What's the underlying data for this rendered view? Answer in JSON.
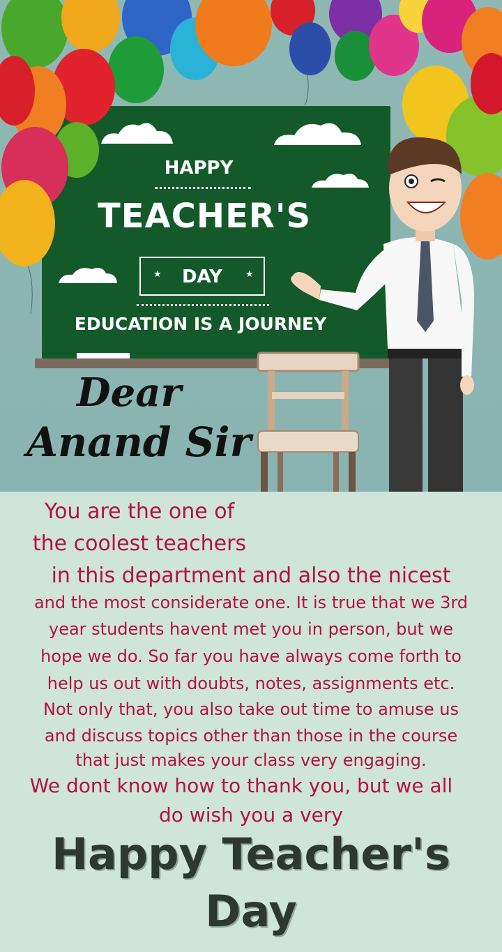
{
  "board": {
    "happy": "HAPPY",
    "teachers": "TEACHER'S",
    "day": "DAY",
    "tagline": "EDUCATION IS A JOURNEY",
    "balloon_text": "HAPPY TEACHER'S DAY"
  },
  "greeting": {
    "line1": "Dear",
    "line2": "Anand Sir"
  },
  "message": {
    "l1": "You are the one of",
    "l2": "the coolest teachers",
    "l3": "in this department and also the nicest",
    "l4": "and the most considerate one. It is true that we 3rd",
    "l5": "year students havent met you in person, but we",
    "l6": "hope we do. So far you have always come forth to",
    "l7": "help us out with doubts, notes, assignments etc.",
    "l8": "Not only that, you also take out time to amuse us",
    "l9": "and discuss topics other than those in the course",
    "l10": "that just makes your class very engaging.",
    "l11": "We dont know how to thank you, but we all",
    "l12": "do wish you a very"
  },
  "closing": {
    "line1": "Happy Teacher's",
    "line2": "Day"
  },
  "colors": {
    "board": "#14592a",
    "message_text": "#b3123f",
    "closing_text": "#2c3830",
    "background": "#cfe5d9"
  },
  "icons": [
    "balloon-icon",
    "cloud-icon",
    "chair-icon",
    "teacher-illustration"
  ]
}
